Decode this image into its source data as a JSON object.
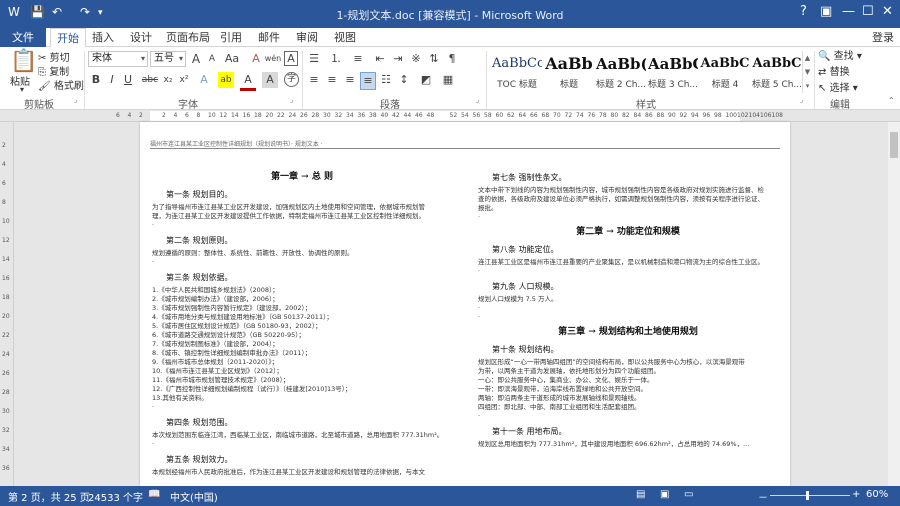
{
  "window": {
    "title": "1-规划文本.doc [兼容模式] - Microsoft Word",
    "controls": {
      "help": "?",
      "restore": "▣",
      "minimize": "—",
      "maximize": "☐",
      "close": "✕"
    }
  },
  "qat": {
    "save": "💾",
    "undo": "↶",
    "redo": "↷",
    "customize": "▾"
  },
  "tabs": [
    "文件",
    "开始",
    "插入",
    "设计",
    "页面布局",
    "引用",
    "邮件",
    "审阅",
    "视图"
  ],
  "active_tab": "开始",
  "login": "登录",
  "ribbon": {
    "clipboard": {
      "paste": "粘贴",
      "cut": "剪切",
      "copy": "复制",
      "format_painter": "格式刷",
      "group": "剪贴板"
    },
    "font": {
      "family": "宋体",
      "size": "五号",
      "grow": "A",
      "shrink": "A",
      "case": "Aa",
      "clear": "A",
      "phonetic": "wén",
      "border_char": "A",
      "bold": "B",
      "italic": "I",
      "underline": "U",
      "strike": "abc",
      "sub": "x₂",
      "sup": "x²",
      "effects": "A",
      "highlight": "ab",
      "color": "A",
      "shade": "A",
      "circle": "字",
      "group": "字体"
    },
    "paragraph": {
      "group": "段落"
    },
    "styles": {
      "items": [
        {
          "preview": "AaBbCc",
          "name": "TOC 标题"
        },
        {
          "preview": "AaBb",
          "name": "标题"
        },
        {
          "preview": "AaBb(",
          "name": "标题 2 Ch..."
        },
        {
          "preview": "AaBbC",
          "name": "标题 3 Ch..."
        },
        {
          "preview": "AaBbC",
          "name": "标题 4"
        },
        {
          "preview": "AaBbC",
          "name": "标题 5 Ch..."
        }
      ],
      "group": "样式"
    },
    "editing": {
      "find": "查找",
      "replace": "替换",
      "select": "选择",
      "group": "编辑"
    }
  },
  "ruler_ticks": [
    "6",
    "4",
    "2",
    "",
    "2",
    "4",
    "6",
    "8",
    "10",
    "12",
    "14",
    "16",
    "18",
    "20",
    "22",
    "24",
    "26",
    "28",
    "30",
    "32",
    "34",
    "36",
    "38",
    "40",
    "42",
    "44",
    "46",
    "48",
    "",
    "52",
    "54",
    "56",
    "58",
    "60",
    "62",
    "64",
    "66",
    "68",
    "70",
    "72",
    "74",
    "76",
    "78",
    "80",
    "82",
    "84",
    "86",
    "88",
    "90",
    "92",
    "94",
    "96",
    "98",
    "100",
    "102",
    "104",
    "106",
    "108"
  ],
  "vruler_ticks": [
    "2",
    "4",
    "6",
    "8",
    "10",
    "12",
    "14",
    "16",
    "18",
    "20",
    "22",
    "24",
    "26",
    "28",
    "30",
    "32",
    "34",
    "36"
  ],
  "document": {
    "header": "福州市连江县某工业区控制性详细规划（规划说明书）· 规划文本 ·",
    "left": [
      {
        "kind": "ch",
        "text": "第一章 → 总 则"
      },
      {
        "kind": "ar",
        "text": "第一条 规划目的。"
      },
      {
        "kind": "p",
        "text": "为了指导福州市连江县某工业区开发建设，加强规划区内土地使用和空间管理，依据城市规划管"
      },
      {
        "kind": "p",
        "text": "理，为连江县某工业区开发建设提供工作依据，特制定福州市连江县某工业区控制性详细规划。"
      },
      {
        "kind": "p",
        "text": "·"
      },
      {
        "kind": "ar",
        "text": "第二条 规划原则。"
      },
      {
        "kind": "p",
        "text": "规划遵循的原则：整体性、系统性、前瞻性、开放性、协调性的原则。"
      },
      {
        "kind": "p",
        "text": "·"
      },
      {
        "kind": "ar",
        "text": "第三条 规划依据。"
      },
      {
        "kind": "p",
        "text": "1.《中华人民共和国城乡规划法》（2008）；"
      },
      {
        "kind": "p",
        "text": "2.《城市规划编制办法》（建设部，2006）；"
      },
      {
        "kind": "p",
        "text": "3.《城市规划强制性内容暂行规定》（建设部，2002）；"
      },
      {
        "kind": "p",
        "text": "4.《城市用地分类与规划建设用地标准》（GB 50137-2011）；"
      },
      {
        "kind": "p",
        "text": "5.《城市居住区规划设计规范》（GB 50180-93，2002）；"
      },
      {
        "kind": "p",
        "text": "6.《城市道路交通规划设计规范》（GB 50220-95）；"
      },
      {
        "kind": "p",
        "text": "7.《城市规划制图标准》（建设部，2004）；"
      },
      {
        "kind": "p",
        "text": "8.《城市、镇控制性详细规划编制审批办法》（2011）；"
      },
      {
        "kind": "p",
        "text": "9.《福州市城市总体规划（2011-2020）》；"
      },
      {
        "kind": "p",
        "text": "10.《福州市连江县某工业区规划》（2012）；"
      },
      {
        "kind": "p",
        "text": "11.《福州市城市规划管理技术规定》（2008）；"
      },
      {
        "kind": "p",
        "text": "12.《广西控制性详细规划编制规程（试行）》（桂建发[2010]13号）；"
      },
      {
        "kind": "p",
        "text": "13.其他有关资料。"
      },
      {
        "kind": "p",
        "text": "·"
      },
      {
        "kind": "ar",
        "text": "第四条 规划范围。"
      },
      {
        "kind": "p",
        "text": "本次规划范围东临连江湾，西临某工业区，南临城市道路，北至城市道路，总用地面积 777.31hm²。"
      },
      {
        "kind": "p",
        "text": "·"
      },
      {
        "kind": "ar",
        "text": "第五条 规划效力。"
      },
      {
        "kind": "p",
        "text": "本规划经福州市人民政府批准后，作为连江县某工业区开发建设和规划管理的法律依据，与本文"
      }
    ],
    "right": [
      {
        "kind": "ar",
        "text": "第七条 强制性条文。"
      },
      {
        "kind": "p",
        "text": "文本中带下划线的内容为规划强制性内容，城市规划强制性内容是各级政府对规划实施进行监督、检"
      },
      {
        "kind": "p",
        "text": "查的依据，各级政府及建设单位必须严格执行，如需调整规划强制性内容，须按有关程序进行论证、"
      },
      {
        "kind": "p",
        "text": "报批。"
      },
      {
        "kind": "p",
        "text": "·"
      },
      {
        "kind": "ch",
        "text": "第二章 → 功能定位和规模"
      },
      {
        "kind": "ar",
        "text": "第八条 功能定位。"
      },
      {
        "kind": "p",
        "text": "连江县某工业区是福州市连江县重要的产业聚集区，是以机械制造和港口物流为主的综合性工业区。"
      },
      {
        "kind": "p",
        "text": "·"
      },
      {
        "kind": "ar",
        "text": "第九条 人口规模。"
      },
      {
        "kind": "p",
        "text": "规划人口规模为 7.5 万人。"
      },
      {
        "kind": "p",
        "text": "·"
      },
      {
        "kind": "p",
        "text": "·"
      },
      {
        "kind": "ch",
        "text": "第三章 → 规划结构和土地使用规划"
      },
      {
        "kind": "ar",
        "text": "第十条 规划结构。"
      },
      {
        "kind": "p",
        "text": "规划区形成“一心一带两轴四组团”的空间结构布局，即以公共服务中心为核心，以滨海景观带"
      },
      {
        "kind": "p",
        "text": "为带，以两条主干道为发展轴，依托地形划分为四个功能组团。"
      },
      {
        "kind": "p",
        "text": "一心：即公共服务中心，集商业、办公、文化、娱乐于一体。"
      },
      {
        "kind": "p",
        "text": "一带：即滨海景观带，沿海岸线布置绿地和公共开放空间。"
      },
      {
        "kind": "p",
        "text": "两轴：即沿两条主干道形成的城市发展轴线和景观轴线。"
      },
      {
        "kind": "p",
        "text": "四组团：即北部、中部、南部工业组团和生活配套组团。"
      },
      {
        "kind": "p",
        "text": "·"
      },
      {
        "kind": "ar",
        "text": "第十一条 用地布局。"
      },
      {
        "kind": "p",
        "text": "规划区总用地面积为 777.31hm²，其中建设用地面积 696.62hm²，占总用地的 74.69%，..."
      }
    ]
  },
  "status": {
    "page": "第 2 页，共 25 页",
    "words": "24533 个字",
    "proof_icon": "📖",
    "language": "中文(中国)",
    "zoom_minus": "－",
    "zoom_plus": "+",
    "zoom": "60%"
  },
  "colors": {
    "accent": "#2b579a",
    "workspace": "#e6e6e6"
  }
}
